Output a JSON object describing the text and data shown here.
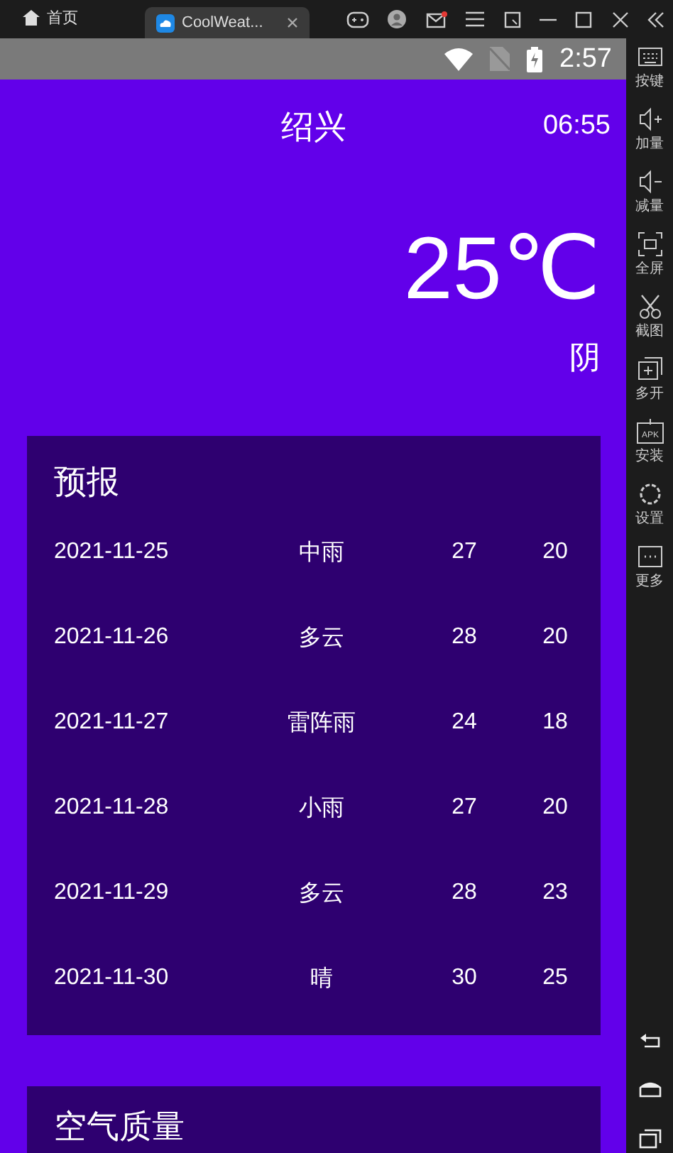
{
  "title_bar": {
    "home_label": "首页",
    "tab_label": "CoolWeat..."
  },
  "status_bar": {
    "time": "2:57"
  },
  "header": {
    "city": "绍兴",
    "update_time": "06:55"
  },
  "now": {
    "temperature": "25℃",
    "weather": "阴"
  },
  "forecast": {
    "title": "预报",
    "rows": [
      {
        "date": "2021-11-25",
        "info": "中雨",
        "max": "27",
        "min": "20"
      },
      {
        "date": "2021-11-26",
        "info": "多云",
        "max": "28",
        "min": "20"
      },
      {
        "date": "2021-11-27",
        "info": "雷阵雨",
        "max": "24",
        "min": "18"
      },
      {
        "date": "2021-11-28",
        "info": "小雨",
        "max": "27",
        "min": "20"
      },
      {
        "date": "2021-11-29",
        "info": "多云",
        "max": "28",
        "min": "23"
      },
      {
        "date": "2021-11-30",
        "info": "晴",
        "max": "30",
        "min": "25"
      }
    ]
  },
  "air_quality": {
    "title": "空气质量"
  },
  "sidebar": [
    {
      "kind": "keyboard",
      "label": "按键"
    },
    {
      "kind": "volup",
      "label": "加量"
    },
    {
      "kind": "voldown",
      "label": "减量"
    },
    {
      "kind": "fullscreen",
      "label": "全屏"
    },
    {
      "kind": "scissors",
      "label": "截图"
    },
    {
      "kind": "multi",
      "label": "多开"
    },
    {
      "kind": "apk",
      "label": "安装",
      "badge": "APK"
    },
    {
      "kind": "settings",
      "label": "设置"
    },
    {
      "kind": "more",
      "label": "更多"
    }
  ]
}
